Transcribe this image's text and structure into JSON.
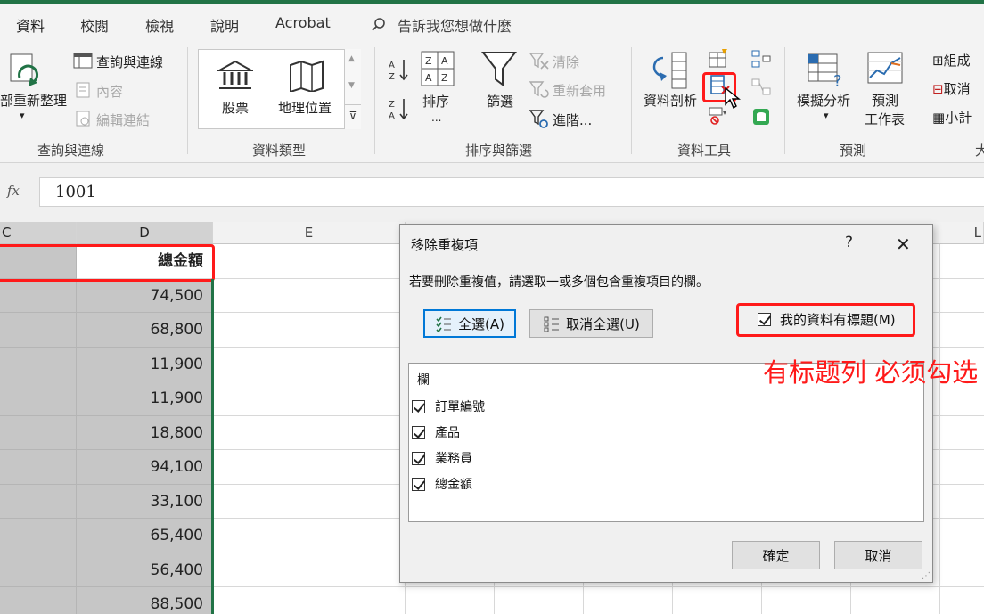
{
  "ribbon_tabs": [
    "資料",
    "校閱",
    "檢視",
    "說明",
    "Acrobat"
  ],
  "tell_me": "告訴我您想做什麼",
  "groups": {
    "query": {
      "label": "查詢與連線",
      "refresh_all": "部重新整理",
      "queries_connections": "查詢與連線",
      "properties": "內容",
      "edit_links": "編輯連結"
    },
    "data_types": {
      "label": "資料類型",
      "stocks": "股票",
      "geography": "地理位置"
    },
    "sort_filter": {
      "label": "排序與篩選",
      "sort": "排序",
      "sort_dots": "...",
      "filter": "篩選",
      "clear": "清除",
      "reapply": "重新套用",
      "advanced": "進階..."
    },
    "data_tools": {
      "label": "資料工具",
      "text_to_columns": "資料剖析"
    },
    "forecast": {
      "label": "預測",
      "what_if": "模擬分析",
      "forecast_sheet_line1": "預測",
      "forecast_sheet_line2": "工作表"
    },
    "outline": {
      "label": "大",
      "group": "組成",
      "ungroup": "取消",
      "subtotal": "小計"
    }
  },
  "formula_bar": {
    "fx": "fx",
    "value": "1001"
  },
  "columns": {
    "C": "C",
    "D": "D",
    "E": "E",
    "L": "L"
  },
  "column_d": {
    "header": "總金額",
    "values": [
      "74,500",
      "68,800",
      "11,900",
      "11,900",
      "18,800",
      "94,100",
      "33,100",
      "65,400",
      "56,400",
      "88,500"
    ]
  },
  "dialog": {
    "title": "移除重複項",
    "help": "?",
    "close": "✕",
    "instruction": "若要刪除重複值，請選取一或多個包含重複項目的欄。",
    "select_all": "全選(A)",
    "unselect_all": "取消全選(U)",
    "has_headers": "我的資料有標題(M)",
    "has_headers_checked": true,
    "column_header": "欄",
    "column_items": [
      {
        "label": "訂單編號",
        "checked": true
      },
      {
        "label": "產品",
        "checked": true
      },
      {
        "label": "業務員",
        "checked": true
      },
      {
        "label": "總金額",
        "checked": true
      }
    ],
    "ok": "確定",
    "cancel": "取消"
  },
  "annotation": {
    "note": "有标题列 必须勾选",
    "color": "#ff1a1a"
  },
  "colors": {
    "excel_green": "#217346",
    "selection_gray": "#c6c6c6"
  }
}
